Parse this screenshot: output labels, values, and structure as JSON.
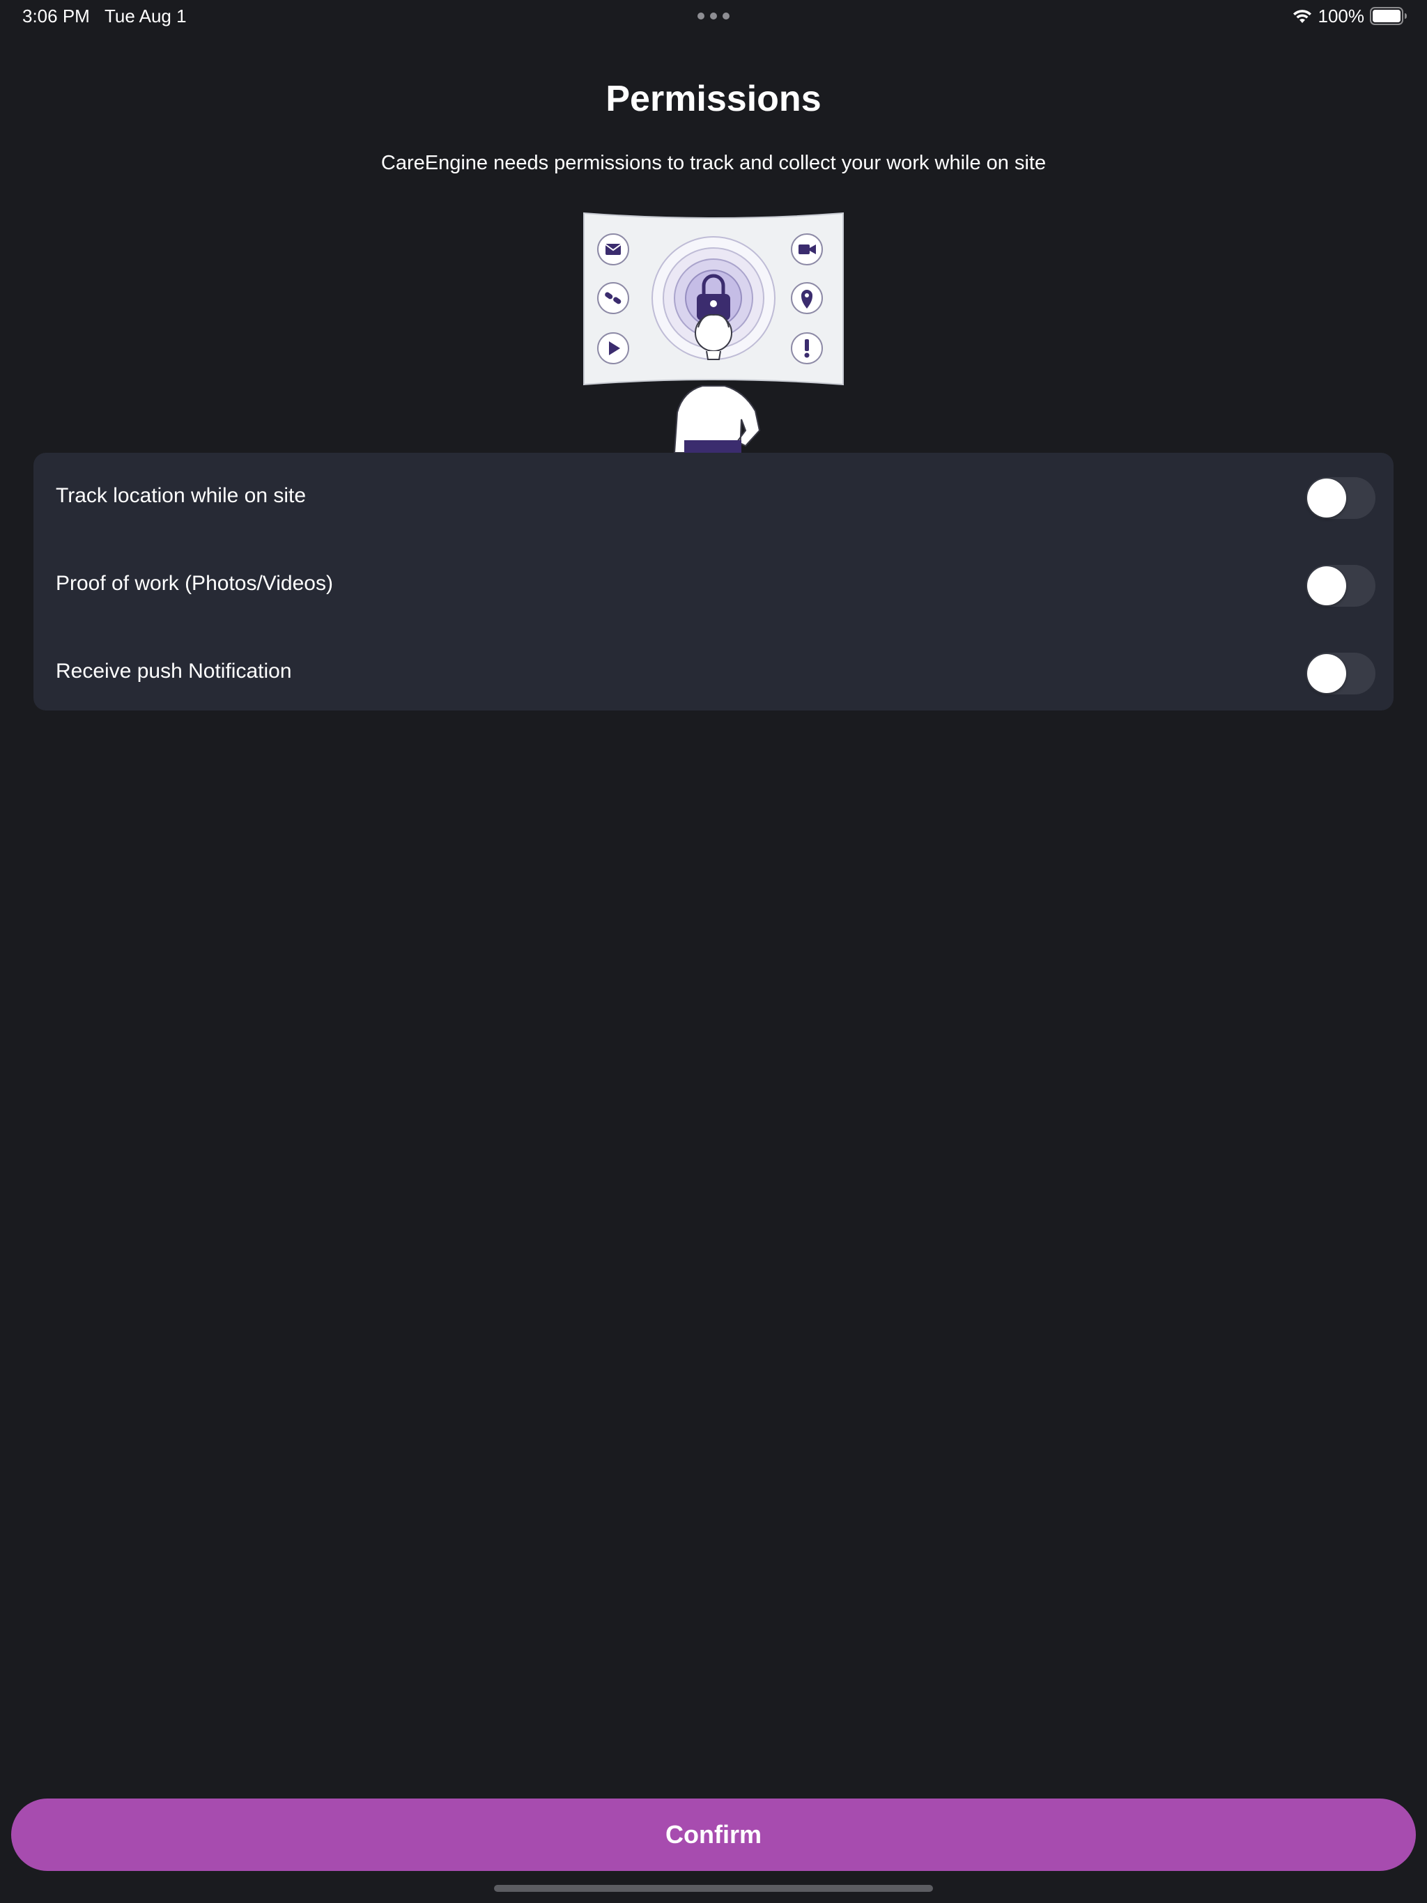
{
  "status_bar": {
    "time": "3:06 PM",
    "date": "Tue Aug 1",
    "battery_percent": "100%",
    "icons": [
      "wifi-icon",
      "battery-icon",
      "multitask-dots-icon"
    ]
  },
  "header": {
    "title": "Permissions",
    "subtitle": "CareEngine needs permissions to track and collect your work while on site"
  },
  "permissions": {
    "items": [
      {
        "label": "Track location while on site",
        "enabled": false
      },
      {
        "label": "Proof of work (Photos/Videos)",
        "enabled": false
      },
      {
        "label": "Receive push Notification",
        "enabled": false
      }
    ]
  },
  "footer": {
    "confirm_label": "Confirm"
  },
  "colors": {
    "background": "#1a1b1f",
    "card": "#272a35",
    "toggle_off": "#393c47",
    "accent": "#a74caf",
    "illustration_purple": "#3b2c6e"
  }
}
